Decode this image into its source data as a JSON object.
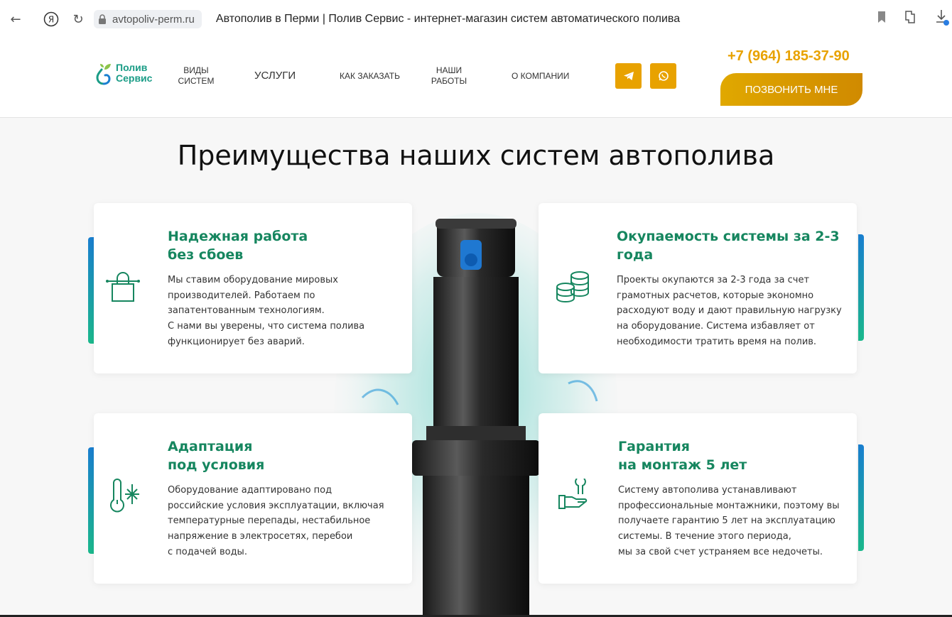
{
  "browser": {
    "url": "avtopoliv-perm.ru",
    "title": "Автополив в Перми | Полив Сервис - интернет-магазин систем автоматического полива"
  },
  "logo": {
    "line1": "Полив",
    "line2": "Сервис"
  },
  "nav": [
    {
      "label": "ВИДЫ\nСИСТЕМ"
    },
    {
      "label": "УСЛУГИ"
    },
    {
      "label": "КАК ЗАКАЗАТЬ"
    },
    {
      "label": "НАШИ\nРАБОТЫ"
    },
    {
      "label": "О КОМПАНИИ"
    }
  ],
  "contacts": {
    "phone": "+7 (964) 185-37-90",
    "call_label": "ПОЗВОНИТЬ МНЕ",
    "socials": [
      "telegram-icon",
      "whatsapp-icon"
    ]
  },
  "section": {
    "title": "Преимущества наших систем автополива",
    "cards": [
      {
        "title": "Надежная работа\nбез сбоев",
        "text": "Мы ставим оборудование мировых\nпроизводителей. Работаем по\nзапатентованным технологиям.\nС нами вы уверены, что система полива\nфункционирует без аварий.",
        "icon": "lock-icon"
      },
      {
        "title": "Окупаемость системы за 2-3\nгода",
        "text": "Проекты окупаются за 2-3 года за счет\nграмотных расчетов, которые экономно\nрасходуют воду и дают правильную нагрузку\nна оборудование. Система избавляет от\nнеобходимости тратить время на полив.",
        "icon": "coins-icon"
      },
      {
        "title": "Адаптация\nпод условия",
        "text": "Оборудование адаптировано под\nроссийские условия эксплуатации, включая\nтемпературные перепады, нестабильное\nнапряжение в электросетях, перебои\nс подачей воды.",
        "icon": "thermometer-snowflake-icon"
      },
      {
        "title": "Гарантия\nна монтаж 5 лет",
        "text": "Систему автополива устанавливают\nпрофессиональные монтажники, поэтому вы\nполучаете гарантию 5 лет на эксплуатацию\nсистемы. В течение этого периода,\nмы за свой счет устраняем все недочеты.",
        "icon": "hand-wrench-icon"
      }
    ]
  },
  "colors": {
    "accent": "#e8a200",
    "green": "#16865f",
    "teal": "#1a9c86"
  }
}
